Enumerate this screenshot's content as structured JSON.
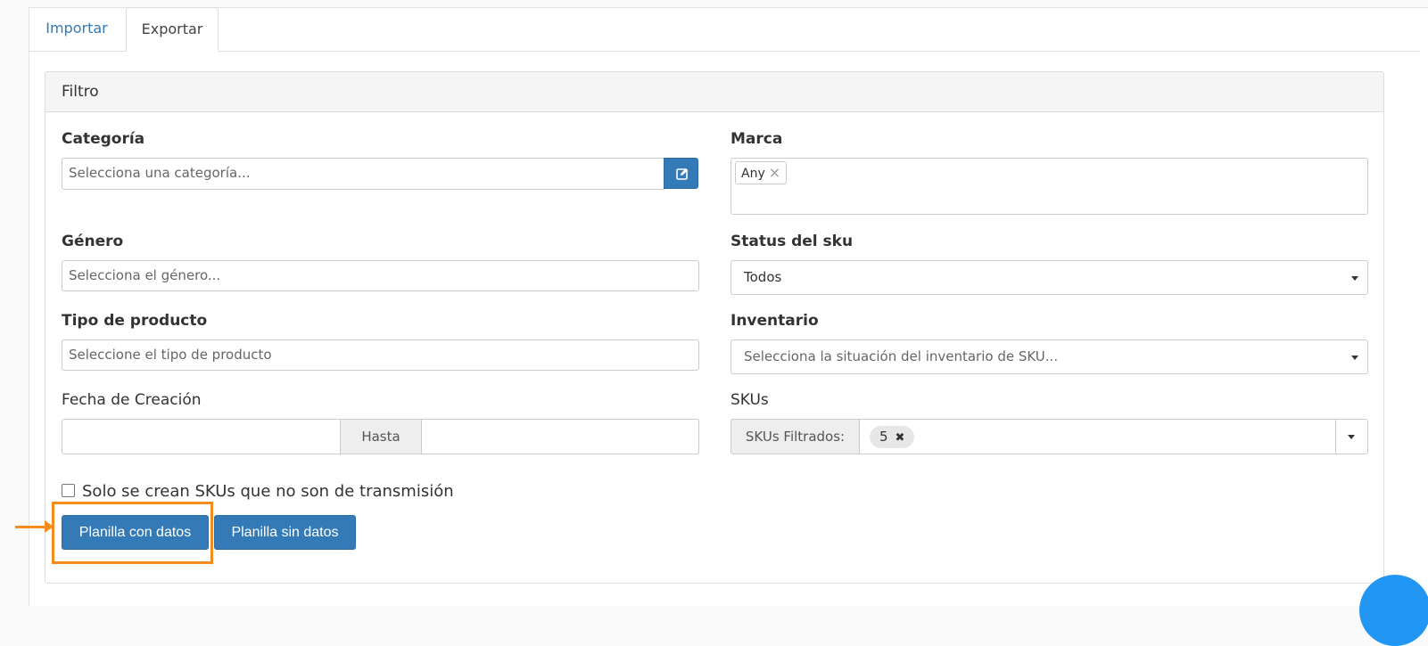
{
  "tabs": {
    "import": "Importar",
    "export": "Exportar"
  },
  "filter": {
    "title": "Filtro",
    "categoria": {
      "label": "Categoría",
      "placeholder": "Selecciona una categoría..."
    },
    "marca": {
      "label": "Marca",
      "tag": "Any",
      "tag_remove": "×"
    },
    "genero": {
      "label": "Género",
      "placeholder": "Selecciona el género..."
    },
    "status": {
      "label": "Status del sku",
      "value": "Todos"
    },
    "tipo": {
      "label": "Tipo de producto",
      "placeholder": "Seleccione el tipo de producto"
    },
    "inventario": {
      "label": "Inventario",
      "placeholder": "Selecciona la situación del inventario de SKU..."
    },
    "fecha": {
      "label": "Fecha de Creación",
      "hasta": "Hasta"
    },
    "skus": {
      "label": "SKUs",
      "addon": "SKUs Filtrados:",
      "chip": "5",
      "chip_remove": "✖"
    },
    "checkbox_label": "Solo se crean SKUs que no son de transmisión"
  },
  "buttons": {
    "con_datos": "Planilla con datos",
    "sin_datos": "Planilla sin datos"
  },
  "colors": {
    "primary": "#337ab7",
    "highlight": "#f38b1d",
    "fab": "#2196f3"
  },
  "icons": {
    "edit": "edit-icon",
    "caret": "caret-down-icon",
    "arrow": "arrow-right-icon"
  }
}
